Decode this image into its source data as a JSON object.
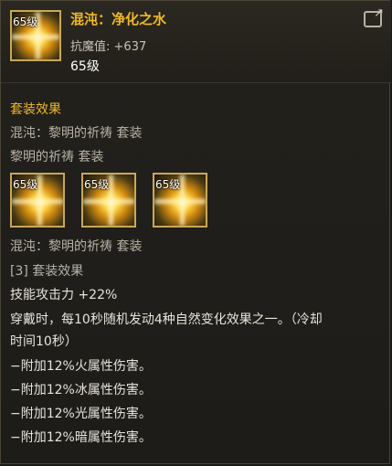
{
  "item": {
    "icon_level": "65级",
    "name": "混沌：净化之水",
    "stat_label": "抗魔值:",
    "stat_value": "+637",
    "level": "65级"
  },
  "set_effect": {
    "title": "套装效果",
    "set_name_line": "混沌：黎明的祈祷  套装",
    "set_short_name": "黎明的祈祷  套装",
    "items": [
      {
        "level": "65级"
      },
      {
        "level": "65级"
      },
      {
        "level": "65级"
      }
    ],
    "set_name_line_2": "混沌：黎明的祈祷  套装",
    "tier_label": "[3] 套装效果",
    "effects": [
      "技能攻击力 +22%",
      "穿戴时，每10秒随机发动4种自然变化效果之一。（冷却",
      "时间10秒）",
      "−附加12%火属性伤害。",
      "−附加12%冰属性伤害。",
      "−附加12%光属性伤害。",
      "−附加12%暗属性伤害。"
    ]
  },
  "colors": {
    "gold": "#f0b828",
    "gray_text": "#b8b3a6",
    "white_text": "#e8e4da",
    "frame": "#c9a85a"
  },
  "icons": {
    "share": "share-icon",
    "item": "equipment-icon"
  }
}
